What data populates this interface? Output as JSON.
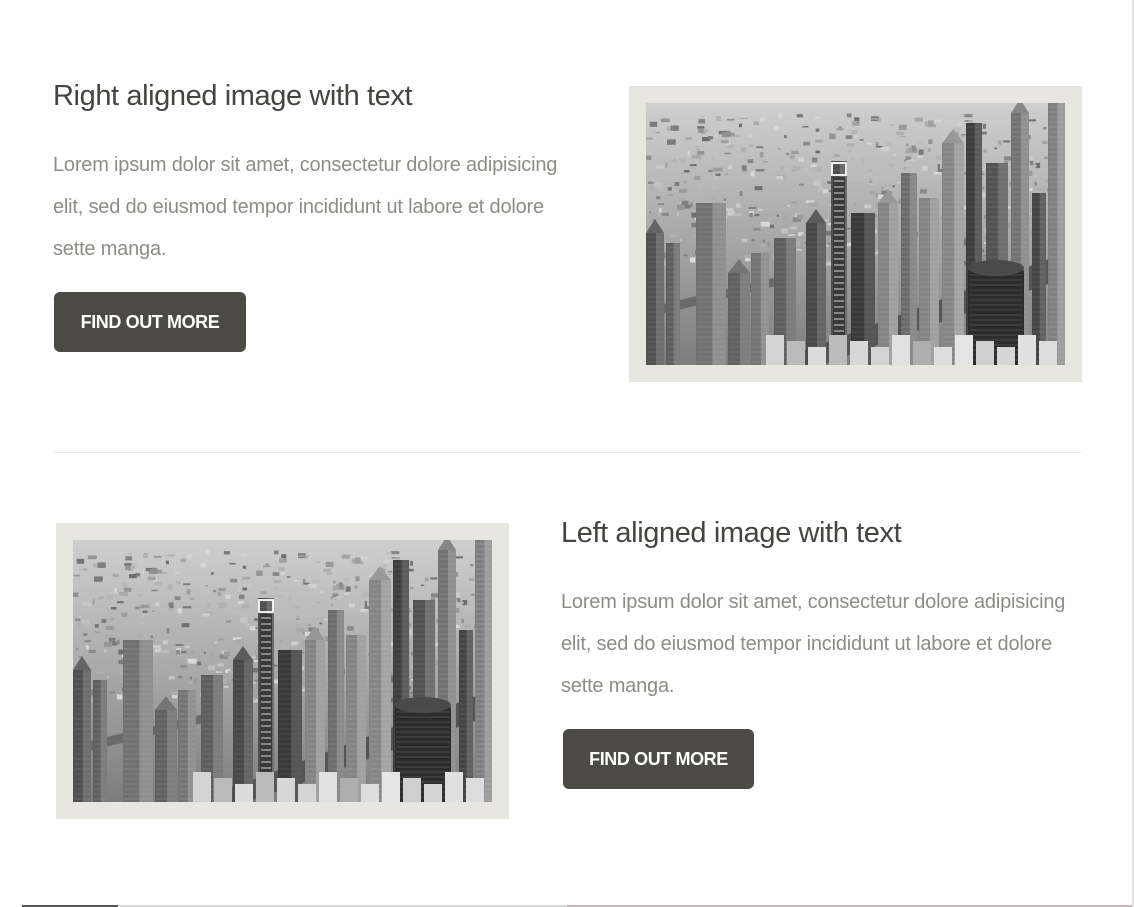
{
  "sections": [
    {
      "heading": "Right aligned image with text",
      "body": "Lorem ipsum dolor sit amet, consectetur dolore adipisicing elit, sed do eiusmod tempor incididunt ut labore et dolore sette manga.",
      "button_label": "FIND OUT MORE",
      "image_side": "right"
    },
    {
      "heading": "Left aligned image with text",
      "body": "Lorem ipsum dolor sit amet, consectetur dolore adipisicing elit, sed do eiusmod tempor incididunt ut labore et dolore sette manga.",
      "button_label": "FIND OUT MORE",
      "image_side": "left"
    }
  ],
  "colors": {
    "button_bg": "#4b4a45",
    "heading": "#444440",
    "body_text": "#8d8d87",
    "image_frame": "#e7e6e1"
  }
}
